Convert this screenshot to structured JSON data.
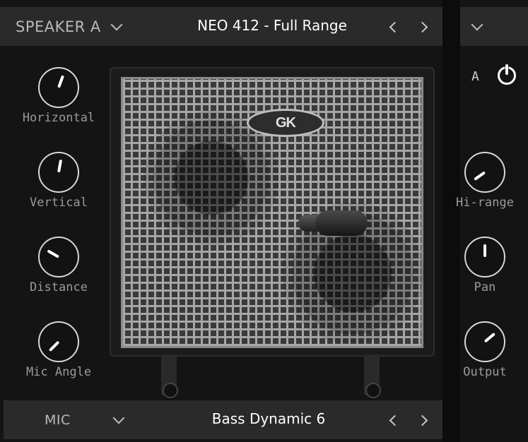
{
  "speaker": {
    "selector_label": "SPEAKER A",
    "preset_name": "NEO 412 - Full Range"
  },
  "mic": {
    "selector_label": "MIC",
    "preset_name": "Bass Dynamic 6"
  },
  "channel": {
    "label": "A"
  },
  "logo_text": "GK",
  "left_knobs": [
    {
      "label": "Horizontal",
      "angle_deg": 20
    },
    {
      "label": "Vertical",
      "angle_deg": 10
    },
    {
      "label": "Distance",
      "angle_deg": -60
    },
    {
      "label": "Mic Angle",
      "angle_deg": -135
    }
  ],
  "right_knobs": [
    {
      "label": "Hi-range",
      "angle_deg": -125
    },
    {
      "label": "Pan",
      "angle_deg": 0
    },
    {
      "label": "Output",
      "angle_deg": 50
    }
  ],
  "colors": {
    "background": "#141414",
    "bar": "#2a2a2a",
    "text": "#cfcfcf"
  }
}
